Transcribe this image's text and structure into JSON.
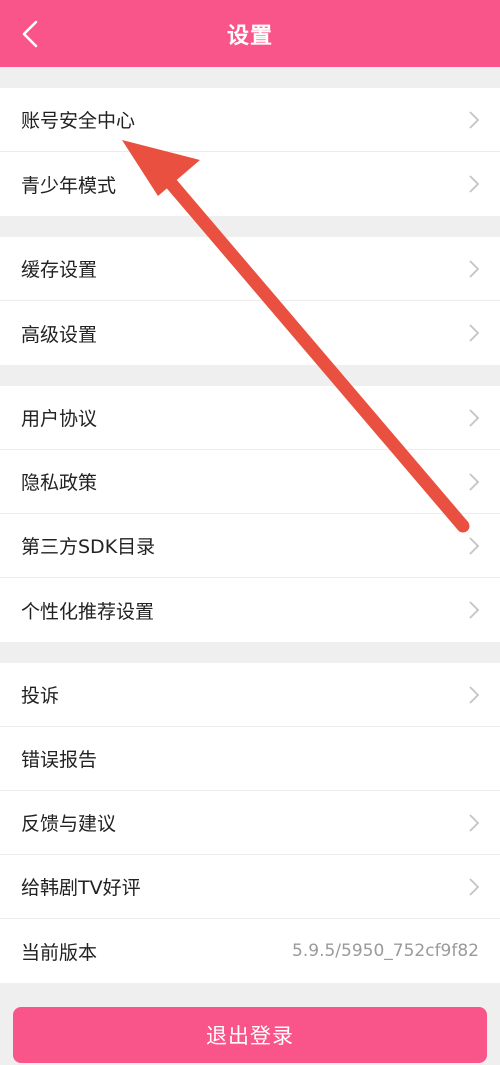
{
  "colors": {
    "accent": "#f9558b",
    "annotation": "#e9503f"
  },
  "header": {
    "title": "设置",
    "back_icon": "chevron-left-icon"
  },
  "groups": [
    {
      "items": [
        {
          "label": "账号安全中心",
          "chevron": true
        },
        {
          "label": "青少年模式",
          "chevron": true
        }
      ]
    },
    {
      "items": [
        {
          "label": "缓存设置",
          "chevron": true
        },
        {
          "label": "高级设置",
          "chevron": true
        }
      ]
    },
    {
      "items": [
        {
          "label": "用户协议",
          "chevron": true
        },
        {
          "label": "隐私政策",
          "chevron": true
        },
        {
          "label": "第三方SDK目录",
          "chevron": true
        },
        {
          "label": "个性化推荐设置",
          "chevron": true
        }
      ]
    },
    {
      "items": [
        {
          "label": "投诉",
          "chevron": true
        },
        {
          "label": "错误报告",
          "chevron": false
        },
        {
          "label": "反馈与建议",
          "chevron": true
        },
        {
          "label": "给韩剧TV好评",
          "chevron": true
        },
        {
          "label": "当前版本",
          "chevron": false,
          "value": "5.9.5/5950_752cf9f82"
        }
      ]
    }
  ],
  "logout": {
    "label": "退出登录"
  }
}
